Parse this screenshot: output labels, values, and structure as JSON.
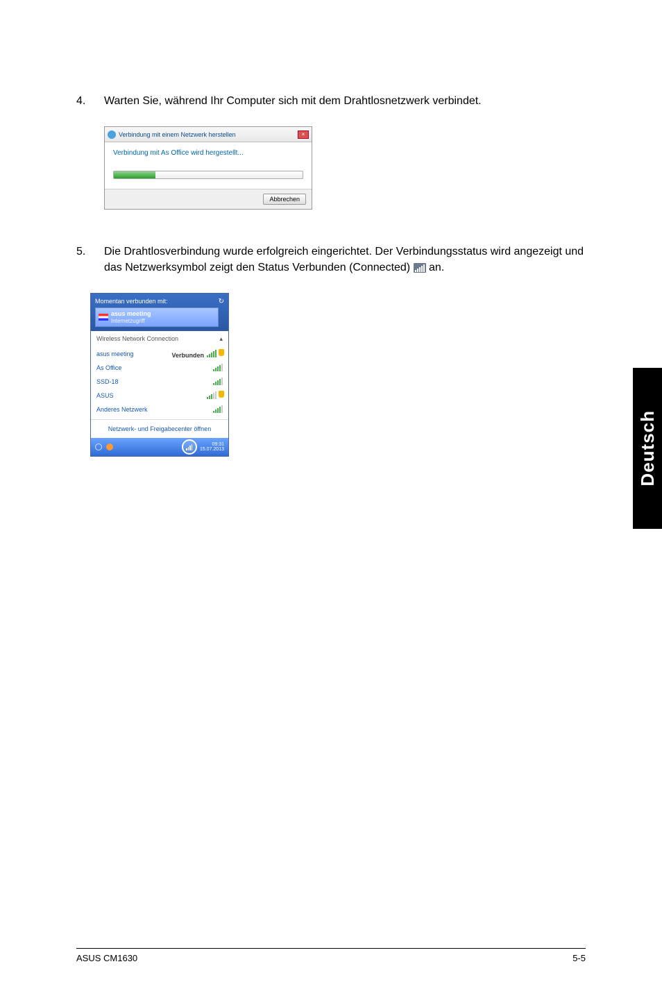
{
  "steps": {
    "four": {
      "num": "4.",
      "text": "Warten Sie, während Ihr Computer sich mit dem Drahtlosnetzwerk verbindet."
    },
    "five": {
      "num": "5.",
      "text_before": "Die Drahtlosverbindung wurde erfolgreich eingerichtet. Der Verbindungsstatus wird angezeigt und das Netzwerksymbol zeigt den Status Verbunden (Connected) ",
      "text_after": " an."
    }
  },
  "dialog1": {
    "title": "Verbindung mit einem Netzwerk herstellen",
    "message": "Verbindung mit As Office wird hergestellt...",
    "cancel": "Abbrechen"
  },
  "popup": {
    "top_title": "Momentan verbunden mit:",
    "current_name": "asus meeting",
    "current_sub": "Internetzugriff",
    "heading": "Wireless Network Connection",
    "networks": [
      {
        "name": "asus meeting",
        "state": "Verbunden",
        "level": "lvl5",
        "shield": true
      },
      {
        "name": "As Office",
        "state": "",
        "level": "lvl4",
        "shield": false
      },
      {
        "name": "SSD-18",
        "state": "",
        "level": "lvl4",
        "shield": false
      },
      {
        "name": "ASUS",
        "state": "",
        "level": "lvl3",
        "shield": true
      },
      {
        "name": "Anderes Netzwerk",
        "state": "",
        "level": "lvl4",
        "shield": false
      }
    ],
    "link": "Netzwerk- und Freigabecenter öffnen",
    "clock_time": "09:31",
    "clock_date": "15.07.2013"
  },
  "side_tab": "Deutsch",
  "footer": {
    "left": "ASUS CM1630",
    "right": "5-5"
  }
}
